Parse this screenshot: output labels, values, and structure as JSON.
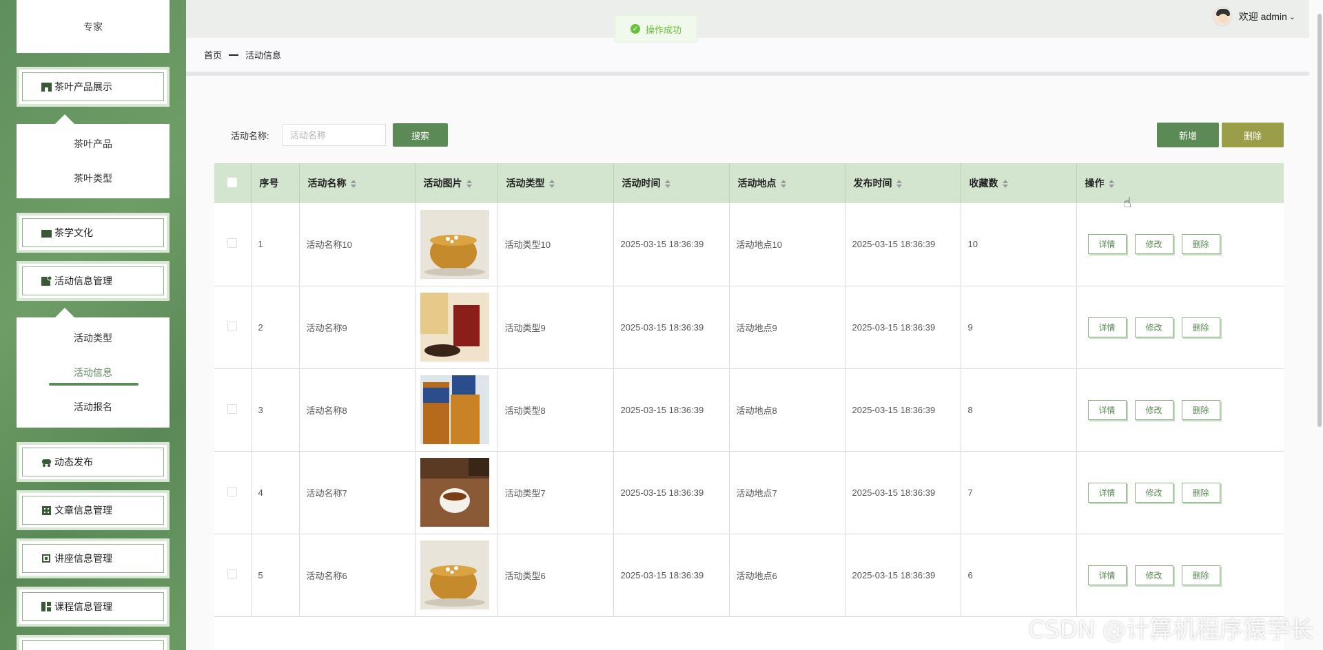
{
  "sidebar": {
    "top_item": "专家",
    "menus": [
      {
        "label": "茶叶产品展示",
        "icon": "store-icon"
      },
      {
        "label": "茶学文化",
        "icon": "book-icon"
      },
      {
        "label": "活动信息管理",
        "icon": "folder-icon"
      },
      {
        "label": "动态发布",
        "icon": "car-icon"
      },
      {
        "label": "文章信息管理",
        "icon": "grid-icon"
      },
      {
        "label": "讲座信息管理",
        "icon": "chip-icon"
      },
      {
        "label": "课程信息管理",
        "icon": "layout-icon"
      }
    ],
    "tea_sub": [
      "茶叶产品",
      "茶叶类型"
    ],
    "activity_sub": [
      "活动类型",
      "活动信息",
      "活动报名"
    ],
    "active_sub": "活动信息"
  },
  "header": {
    "toast": "操作成功",
    "welcome": "欢迎 admin"
  },
  "breadcrumb": [
    "首页",
    "活动信息"
  ],
  "search": {
    "label": "活动名称:",
    "placeholder": "活动名称",
    "button": "搜索"
  },
  "actions": {
    "add": "新增",
    "delete": "删除"
  },
  "table": {
    "columns": [
      "序号",
      "活动名称",
      "活动图片",
      "活动类型",
      "活动时间",
      "活动地点",
      "发布时间",
      "收藏数",
      "操作"
    ],
    "rows": [
      {
        "no": "1",
        "name": "活动名称10",
        "type": "活动类型10",
        "time": "2025-03-15 18:36:39",
        "place": "活动地点10",
        "pub": "2025-03-15 18:36:39",
        "fav": "10",
        "img": "tea-cup-flowers"
      },
      {
        "no": "2",
        "name": "活动名称9",
        "type": "活动类型9",
        "time": "2025-03-15 18:36:39",
        "place": "活动地点9",
        "pub": "2025-03-15 18:36:39",
        "fav": "9",
        "img": "red-tea-glass"
      },
      {
        "no": "3",
        "name": "活动名称8",
        "type": "活动类型8",
        "time": "2025-03-15 18:36:39",
        "place": "活动地点8",
        "pub": "2025-03-15 18:36:39",
        "fav": "8",
        "img": "bottled-tea"
      },
      {
        "no": "4",
        "name": "活动名称7",
        "type": "活动类型7",
        "time": "2025-03-15 18:36:39",
        "place": "活动地点7",
        "pub": "2025-03-15 18:36:39",
        "fav": "7",
        "img": "pouring-tea"
      },
      {
        "no": "5",
        "name": "活动名称6",
        "type": "活动类型6",
        "time": "2025-03-15 18:36:39",
        "place": "活动地点6",
        "pub": "2025-03-15 18:36:39",
        "fav": "6",
        "img": "tea-cup-flowers"
      }
    ],
    "row_ops": [
      "详情",
      "修改",
      "删除"
    ]
  },
  "watermark": "CSDN @计算机程序猿学长",
  "colors": {
    "brand": "#5b8a56",
    "delete": "#9a9e49",
    "header": "#d3e4cf",
    "success": "#67c23a"
  }
}
